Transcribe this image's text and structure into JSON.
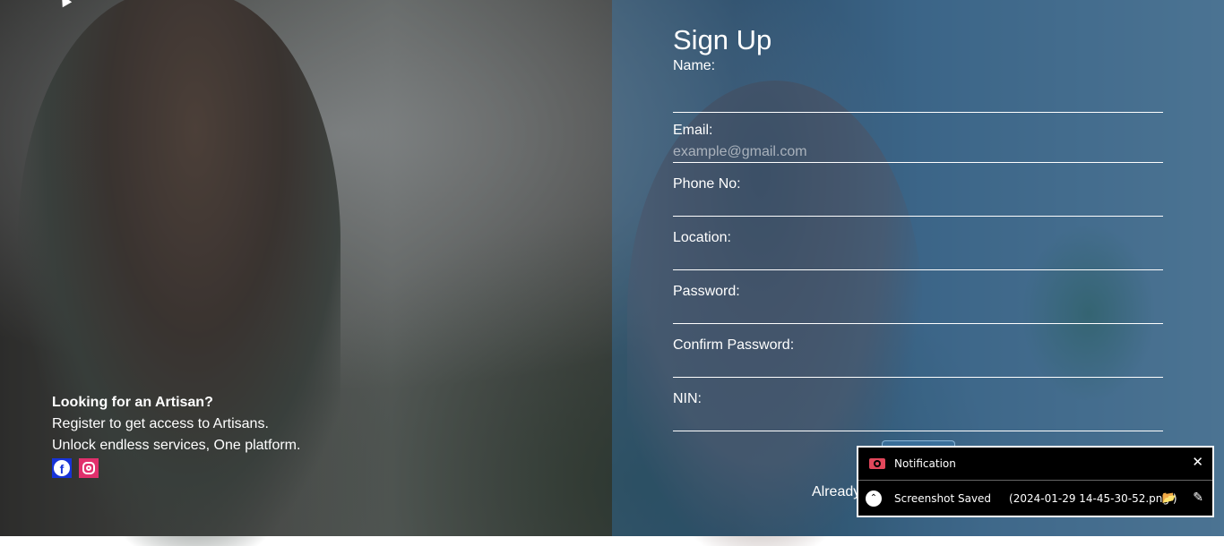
{
  "promo": {
    "headline": "Looking for an Artisan?",
    "line1": "Register to get access to Artisans.",
    "line2": "Unlock endless services, One platform."
  },
  "social": {
    "facebook_letter": "f"
  },
  "form": {
    "title": "Sign Up",
    "fields": [
      {
        "label": "Name:",
        "placeholder": ""
      },
      {
        "label": "Email:",
        "placeholder": "example@gmail.com"
      },
      {
        "label": "Phone No:",
        "placeholder": ""
      },
      {
        "label": "Location:",
        "placeholder": ""
      },
      {
        "label": "Password:",
        "placeholder": ""
      },
      {
        "label": "Confirm Password:",
        "placeholder": ""
      },
      {
        "label": "NIN:",
        "placeholder": ""
      }
    ],
    "already_text": "Already"
  },
  "notification": {
    "title": "Notification",
    "close_glyph": "✕",
    "status": "Screenshot Saved",
    "filename": "(2024-01-29 14-45-30-52.png )",
    "chevron_glyph": "⌃",
    "folder_glyph": "📂",
    "pencil_glyph": "✎"
  }
}
